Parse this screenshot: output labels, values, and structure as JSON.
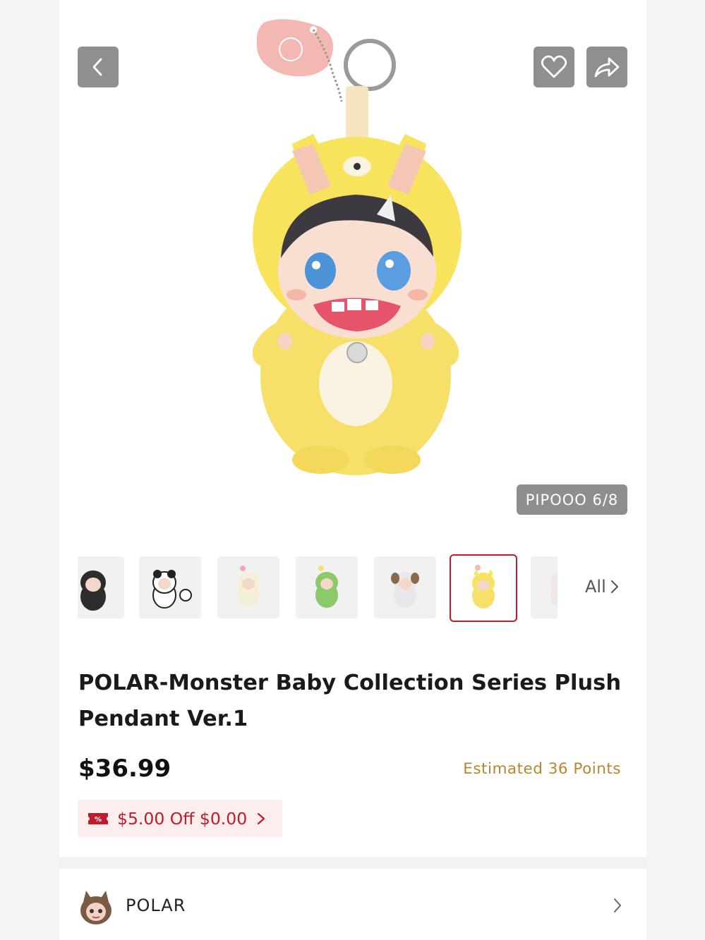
{
  "header": {
    "back_icon": "chevron-left-icon",
    "favorite_icon": "heart-icon",
    "share_icon": "share-icon"
  },
  "gallery": {
    "counter": "PIPOOO 6/8",
    "current_index": 6,
    "total": 8,
    "all_label": "All"
  },
  "product": {
    "title": "POLAR-Monster Baby Collection Series Plush Pendant Ver.1",
    "price": "$36.99",
    "points": "Estimated 36 Points"
  },
  "coupon": {
    "text": "$5.00 Off $0.00",
    "icon": "discount-ticket-icon"
  },
  "brand": {
    "name": "POLAR"
  },
  "colors": {
    "accent_red": "#c01a2c",
    "points_gold": "#b8862f",
    "coupon_bg": "#fdeeee",
    "plush_yellow": "#f7e35c"
  }
}
